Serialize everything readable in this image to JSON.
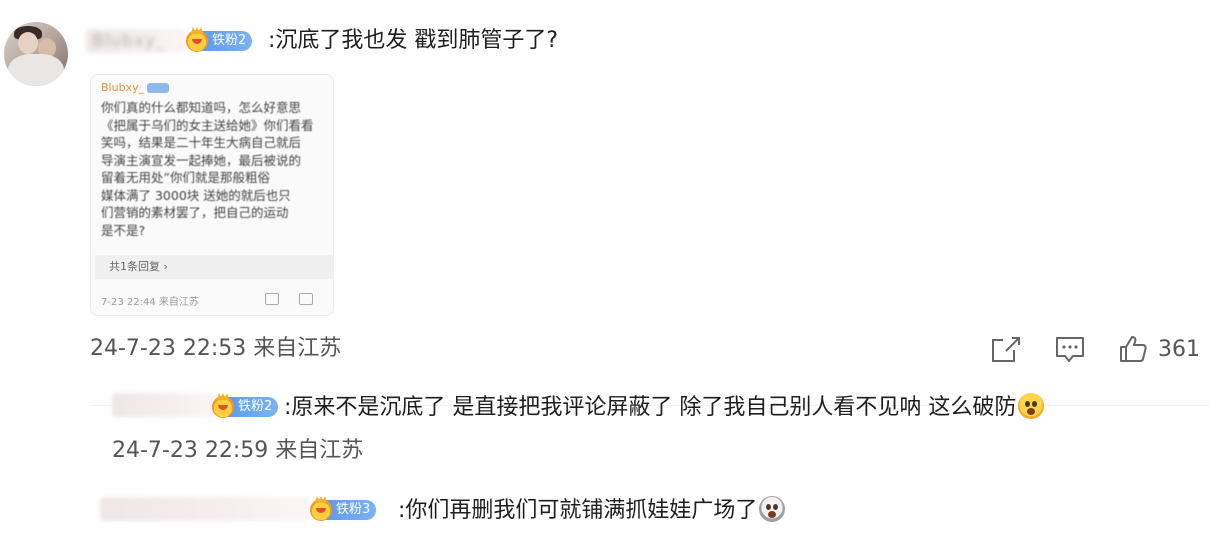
{
  "main_comment": {
    "username": "Blubxy_",
    "fan_badge": "铁粉2",
    "text": ":沉底了我也发 戳到肺管子了?",
    "timestamp": "24-7-23 22:53 来自江苏",
    "like_count": "361"
  },
  "quoted_post": {
    "username": "Blubxy_",
    "body": "你们真的什么都知道吗，怎么好意思\n《把属于乌们的女主送给她》你们看看\n笑吗，结果是二十年生大病自己就后\n导演主演宣发一起捧她，最后被说的\n留着无用处”你们就是那般粗俗\n媒体满了 3000块 送她的就后也只\n们营销的素材罢了，把自己的运动\n是不是?",
    "more_link": "共1条回复 ›",
    "timestamp": "7-23 22:44 来自江苏"
  },
  "replies": [
    {
      "username": "████████",
      "fan_badge": "铁粉2",
      "text": ":原来不是沉底了 是直接把我评论屏蔽了 除了我自己别人看不见呐 这么破防",
      "emoji": "scream-emoji",
      "timestamp": "24-7-23 22:59 来自江苏"
    },
    {
      "username": "████████",
      "fan_badge": "铁粉3",
      "text": ":你们再删我们可就铺满抓娃娃广场了",
      "emoji": "scared-emoji"
    }
  ],
  "colors": {
    "badge_blue": "#6fa8ee",
    "badge_gold": "#f7b21e",
    "text": "#1e1e1e",
    "meta": "#555555"
  }
}
